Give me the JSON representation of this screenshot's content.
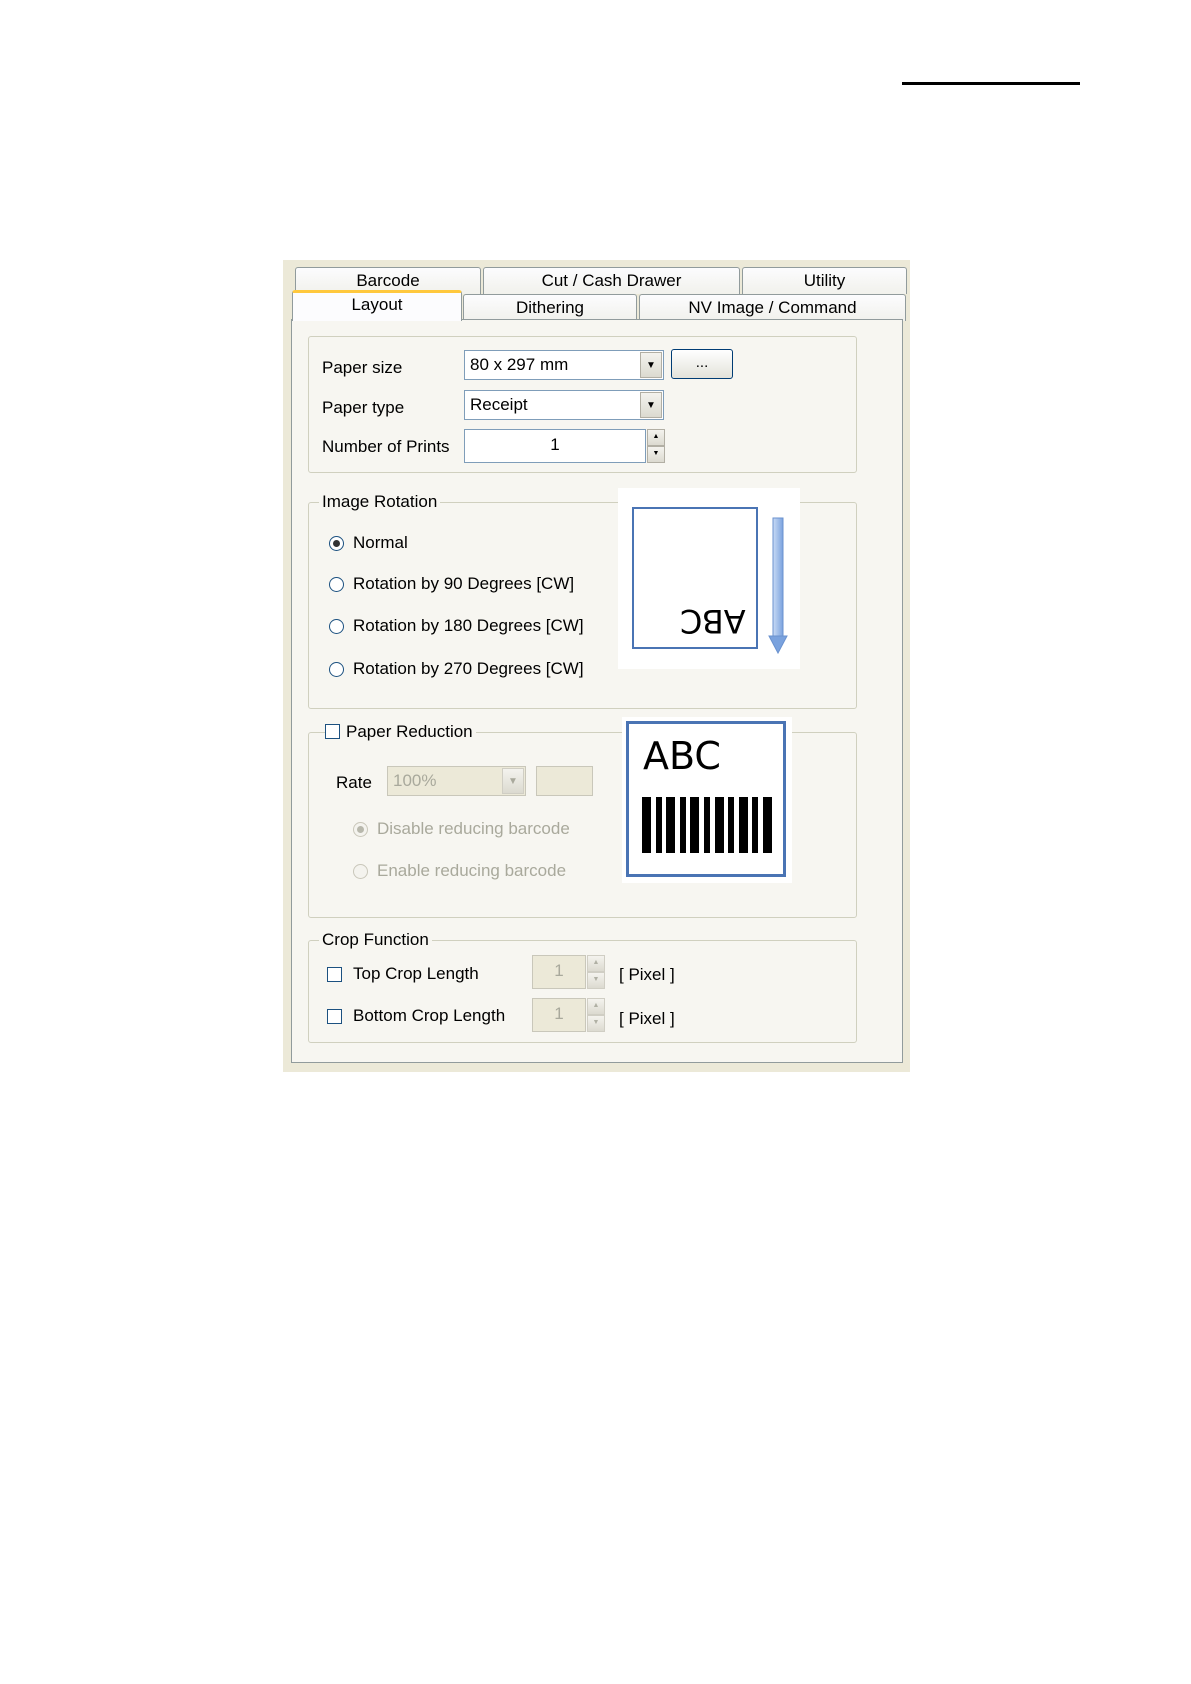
{
  "tabs": {
    "row1": [
      "Barcode",
      "Cut / Cash Drawer",
      "Utility"
    ],
    "row2": [
      "Layout",
      "Dithering",
      "NV Image / Command"
    ],
    "active": "Layout"
  },
  "paper": {
    "size_label": "Paper size",
    "size_value": "80 x 297 mm",
    "browse_label": "...",
    "type_label": "Paper type",
    "type_value": "Receipt",
    "prints_label": "Number of Prints",
    "prints_value": "1"
  },
  "rotation": {
    "title": "Image Rotation",
    "options": [
      "Normal",
      "Rotation by 90 Degrees [CW]",
      "Rotation by 180 Degrees [CW]",
      "Rotation by 270 Degrees [CW]"
    ],
    "selected": "Normal",
    "preview_text": "ABC"
  },
  "reduction": {
    "title": "Paper Reduction",
    "rate_label": "Rate",
    "rate_value": "100%",
    "options": [
      "Disable reducing barcode",
      "Enable reducing barcode"
    ],
    "selected": "Disable reducing barcode",
    "preview_text": "ABC"
  },
  "crop": {
    "title": "Crop Function",
    "top_label": "Top Crop Length",
    "top_value": "1",
    "bottom_label": "Bottom Crop Length",
    "bottom_value": "1",
    "unit": "[ Pixel ]"
  },
  "colors": {
    "dialog_bg": "#ece9d8",
    "panel_bg": "#f7f6f1",
    "active_tab_accent": "#ffc83d",
    "preview_border": "#4a74b4",
    "arrow_blue": "#8fb4e8"
  }
}
